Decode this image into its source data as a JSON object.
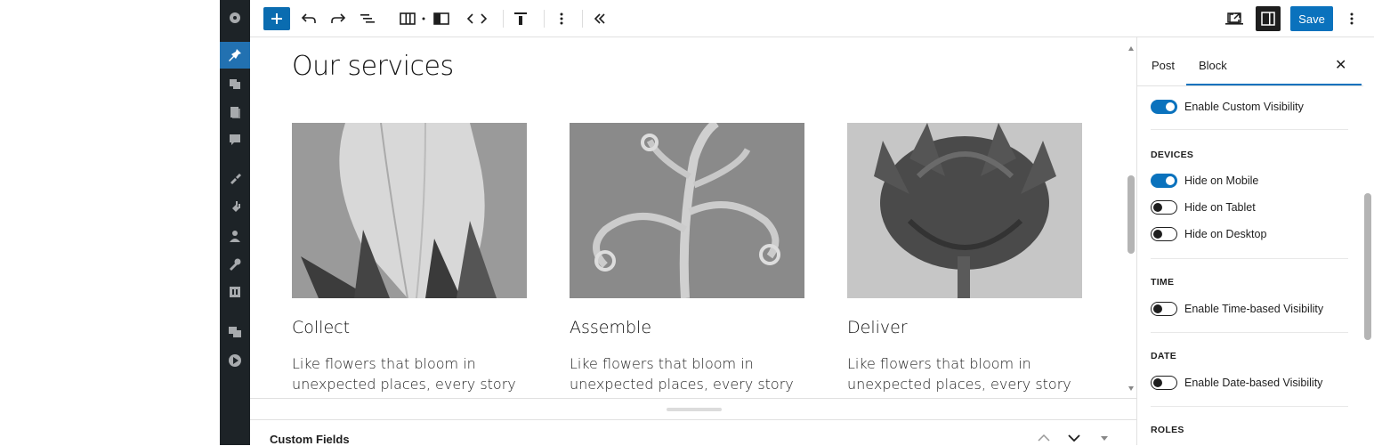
{
  "toolbar": {
    "save_label": "Save"
  },
  "content": {
    "heading": "Our services",
    "columns": [
      {
        "title": "Collect",
        "text": "Like flowers that bloom in unexpected places, every story"
      },
      {
        "title": "Assemble",
        "text": "Like flowers that bloom in unexpected places, every story"
      },
      {
        "title": "Deliver",
        "text": "Like flowers that bloom in unexpected places, every story"
      }
    ]
  },
  "meta": {
    "custom_fields_label": "Custom Fields"
  },
  "inspector": {
    "tabs": {
      "post": "Post",
      "block": "Block"
    },
    "enable_custom_visibility": "Enable Custom Visibility",
    "devices": {
      "heading": "DEVICES",
      "mobile": "Hide on Mobile",
      "tablet": "Hide on Tablet",
      "desktop": "Hide on Desktop"
    },
    "time": {
      "heading": "TIME",
      "label": "Enable Time-based Visibility"
    },
    "date": {
      "heading": "DATE",
      "label": "Enable Date-based Visibility"
    },
    "roles": {
      "heading": "ROLES"
    },
    "toggles": {
      "custom_visibility": true,
      "hide_mobile": true,
      "hide_tablet": false,
      "hide_desktop": false,
      "time_based": false,
      "date_based": false
    }
  },
  "colors": {
    "accent": "#0a72bd",
    "admin_bg": "#1d2327",
    "admin_active": "#2271b1"
  }
}
